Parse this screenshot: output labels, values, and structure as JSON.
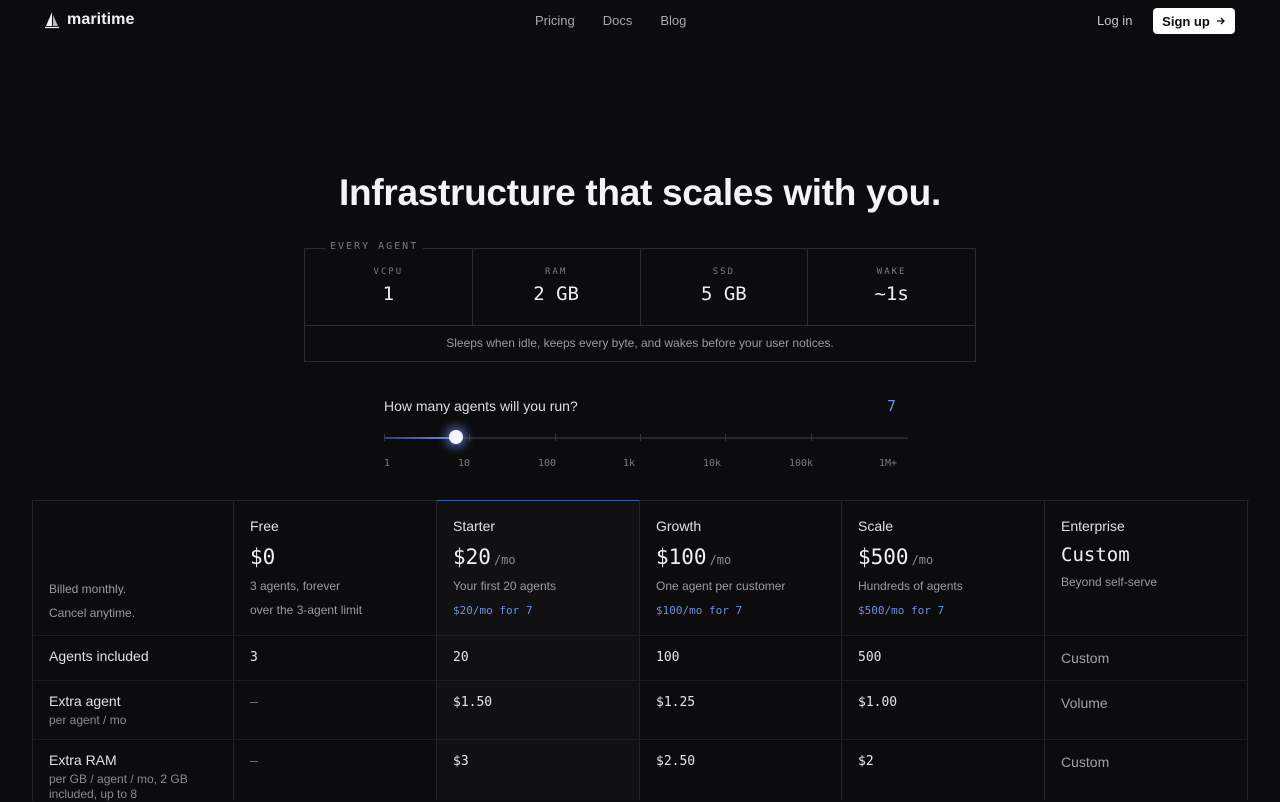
{
  "header": {
    "logo_text": "maritime",
    "nav": [
      "Pricing",
      "Docs",
      "Blog"
    ],
    "login_label": "Log in",
    "signup_label": "Sign up"
  },
  "hero": {
    "title": "Infrastructure that scales with you."
  },
  "spec": {
    "legend": "EVERY AGENT",
    "items": [
      {
        "label": "VCPU",
        "value": "1"
      },
      {
        "label": "RAM",
        "value": "2 GB"
      },
      {
        "label": "SSD",
        "value": "5 GB"
      },
      {
        "label": "WAKE",
        "value": "~1s"
      }
    ],
    "note": "Sleeps when idle, keeps every byte, and wakes before your user notices."
  },
  "slider": {
    "question": "How many agents will you run?",
    "value": "7",
    "ticks": [
      "1",
      "10",
      "100",
      "1k",
      "10k",
      "100k",
      "1M+"
    ],
    "accent": "#6e8fd9"
  },
  "pricing": {
    "billing_line1": "Billed monthly.",
    "billing_line2": "Cancel anytime.",
    "tiers": [
      {
        "name": "Free",
        "price": "$0",
        "per": "",
        "sub": "3 agents, forever",
        "note": "over the 3-agent limit"
      },
      {
        "name": "Starter",
        "price": "$20",
        "per": "/mo",
        "sub": "Your first 20 agents",
        "calc": "$20/mo for 7"
      },
      {
        "name": "Growth",
        "price": "$100",
        "per": "/mo",
        "sub": "One agent per customer",
        "calc": "$100/mo for 7"
      },
      {
        "name": "Scale",
        "price": "$500",
        "per": "/mo",
        "sub": "Hundreds of agents",
        "calc": "$500/mo for 7"
      },
      {
        "name": "Enterprise",
        "price": "Custom",
        "per": "",
        "sub": "Beyond self-serve"
      }
    ],
    "rows": [
      {
        "label": "Agents included",
        "sub": "",
        "values": [
          "3",
          "20",
          "100",
          "500",
          "Custom"
        ]
      },
      {
        "label": "Extra agent",
        "sub": "per agent / mo",
        "values": [
          "—",
          "$1.50",
          "$1.25",
          "$1.00",
          "Volume"
        ]
      },
      {
        "label": "Extra RAM",
        "sub": "per GB / agent / mo, 2 GB included, up to 8",
        "values": [
          "—",
          "$3",
          "$2.50",
          "$2",
          "Custom"
        ]
      }
    ]
  }
}
